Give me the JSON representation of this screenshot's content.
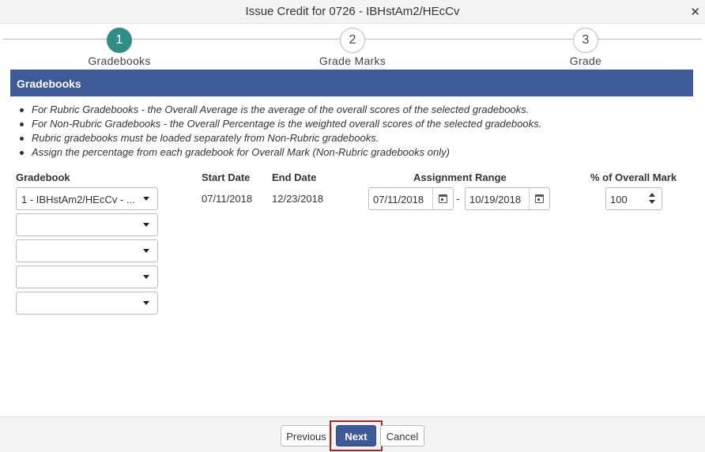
{
  "dialog": {
    "title": "Issue Credit for 0726 - IBHstAm2/HEcCv",
    "close_icon": "close-icon"
  },
  "steps": [
    {
      "number": "1",
      "label": "Gradebooks",
      "active": true
    },
    {
      "number": "2",
      "label": "Grade Marks",
      "active": false
    },
    {
      "number": "3",
      "label": "Grade",
      "active": false
    }
  ],
  "section": {
    "title": "Gradebooks"
  },
  "notes": [
    "For Rubric Gradebooks - the Overall Average is the average of the overall scores of the selected gradebooks.",
    "For Non-Rubric Gradebooks - the Overall Percentage is the weighted overall scores of the selected gradebooks.",
    "Rubric gradebooks must be loaded separately from Non-Rubric gradebooks.",
    "Assign the percentage from each gradebook for Overall Mark (Non-Rubric gradebooks only)"
  ],
  "table": {
    "headers": {
      "gradebook": "Gradebook",
      "start_date": "Start Date",
      "end_date": "End Date",
      "assignment_range": "Assignment Range",
      "overall_mark": "% of Overall Mark"
    },
    "rows": [
      {
        "gradebook": "1 - IBHstAm2/HEcCv - ...",
        "start_date": "07/11/2018",
        "end_date": "12/23/2018",
        "range_from": "07/11/2018",
        "range_separator": "-",
        "range_to": "10/19/2018",
        "overall_mark": "100"
      }
    ],
    "empty_selects": [
      "",
      "",
      "",
      ""
    ]
  },
  "footer": {
    "previous_label": "Previous",
    "next_label": "Next",
    "cancel_label": "Cancel"
  },
  "colors": {
    "accent": "#3d5a99",
    "step_active": "#2d8f86",
    "highlight": "#b32424"
  }
}
